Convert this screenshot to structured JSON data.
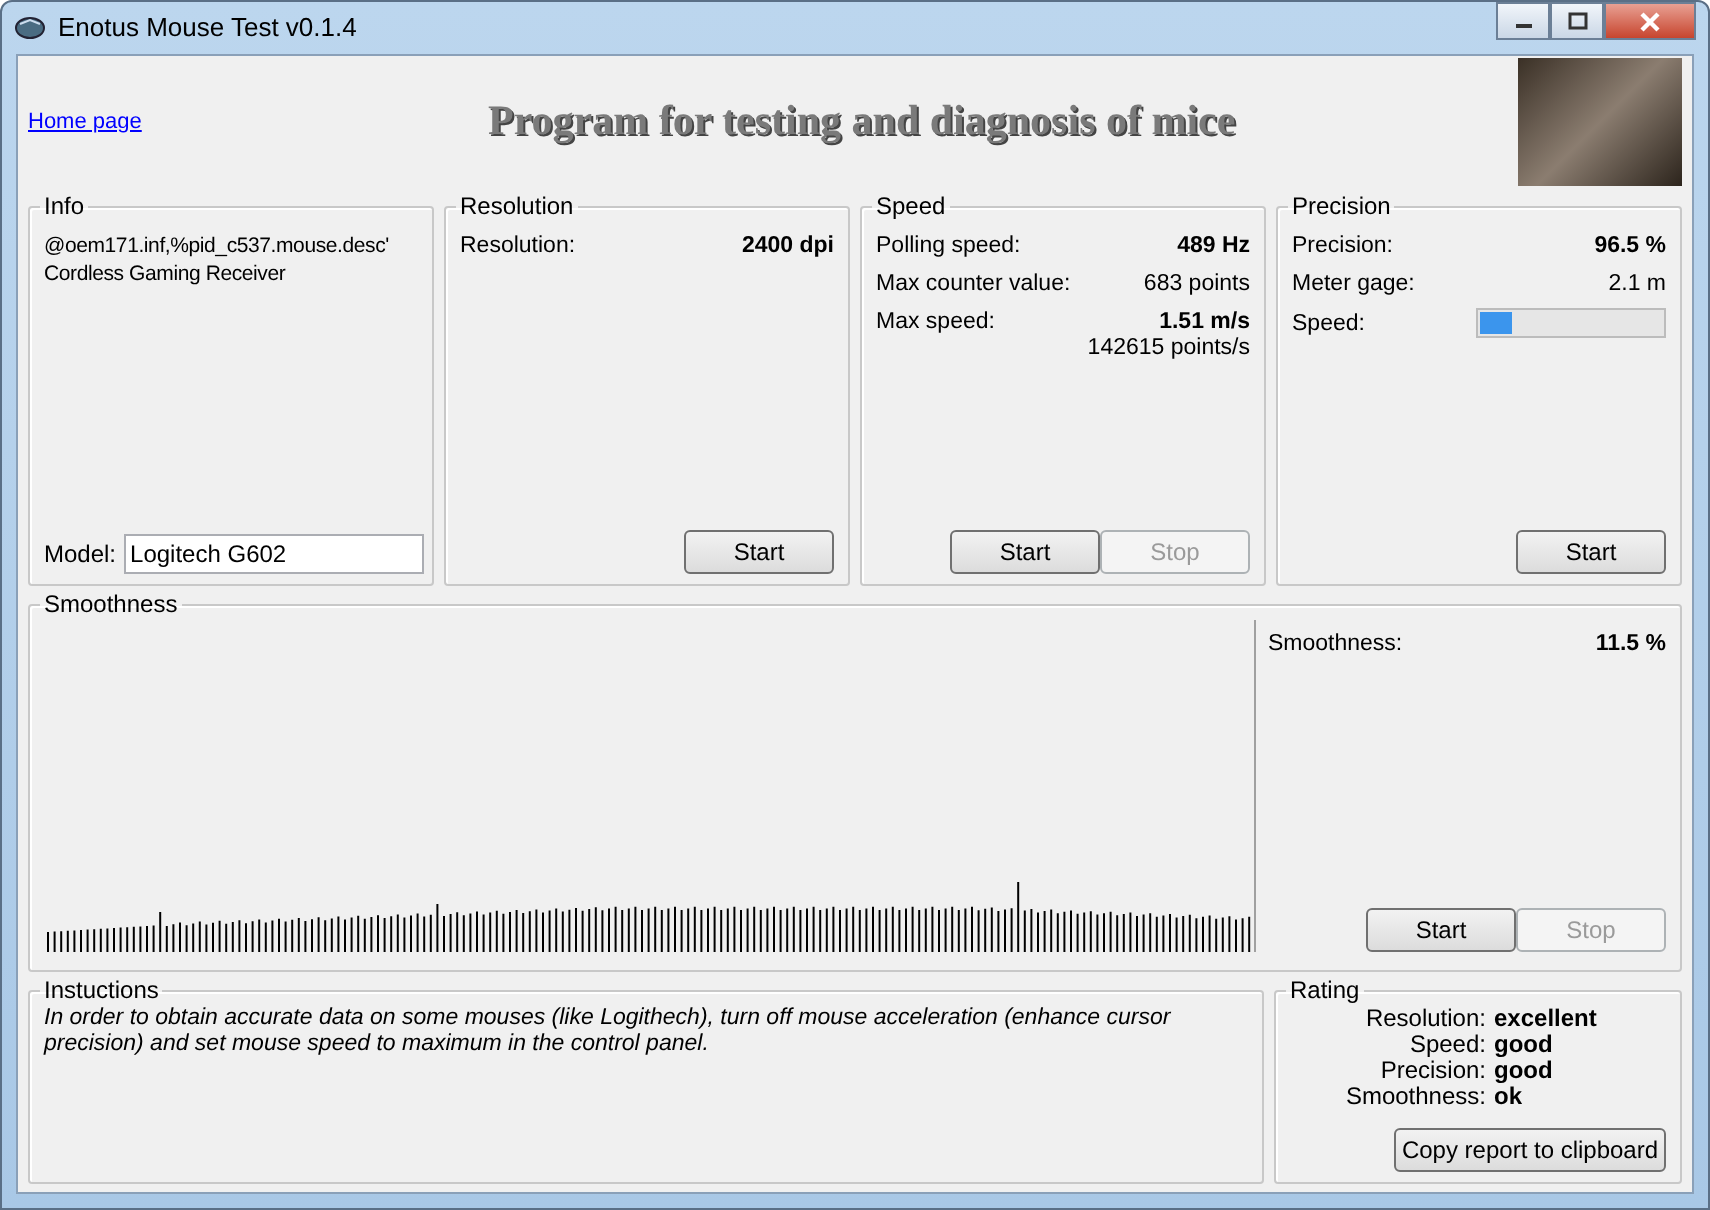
{
  "window": {
    "title": "Enotus Mouse Test v0.1.4"
  },
  "header": {
    "home_link": "Home page",
    "heading": "Program for testing and diagnosis of mice"
  },
  "info": {
    "title": "Info",
    "lines": [
      "@oem171.inf,%pid_c537.mouse.desc'",
      "Cordless Gaming Receiver"
    ],
    "model_label": "Model:",
    "model_value": "Logitech G602"
  },
  "panels": [
    {
      "title": "Resolution",
      "rows": [
        {
          "kind": "value",
          "label": "Resolution:",
          "value": "2400 dpi",
          "bold": true
        }
      ],
      "buttons": [
        {
          "label": "Start",
          "disabled": false
        }
      ]
    },
    {
      "title": "Speed",
      "rows": [
        {
          "kind": "value",
          "label": "Polling speed:",
          "value": "489 Hz",
          "bold": true
        },
        {
          "kind": "value",
          "label": "Max counter value:",
          "value": "683 points",
          "bold": false
        },
        {
          "kind": "value",
          "label": "Max  speed:",
          "value": "1.51 m/s",
          "bold": true,
          "sub": "142615 points/s"
        }
      ],
      "buttons": [
        {
          "label": "Start",
          "disabled": false
        },
        {
          "label": "Stop",
          "disabled": true
        }
      ]
    },
    {
      "title": "Precision",
      "rows": [
        {
          "kind": "value",
          "label": "Precision:",
          "value": "96.5 %",
          "bold": true
        },
        {
          "kind": "value",
          "label": "Meter gage:",
          "value": "2.1 m",
          "bold": false
        },
        {
          "kind": "meter",
          "label": "Speed:",
          "level": 0.18
        }
      ],
      "buttons": [
        {
          "label": "Start",
          "disabled": false
        }
      ]
    }
  ],
  "smoothness": {
    "title": "Smoothness",
    "rows": [
      {
        "kind": "value",
        "label": "Smoothness:",
        "value": "11.5 %",
        "bold": true
      }
    ],
    "buttons": [
      {
        "label": "Start",
        "disabled": false
      },
      {
        "label": "Stop",
        "disabled": true
      }
    ]
  },
  "instructions": {
    "title": "Instuctions",
    "text": "In order to obtain accurate data on some mouses (like Logithech), turn off mouse acceleration (enhance cursor precision) and set mouse speed to maximum in the control panel."
  },
  "rating": {
    "title": "Rating",
    "items": [
      {
        "label": "Resolution:",
        "value": "excellent"
      },
      {
        "label": "Speed:",
        "value": "good"
      },
      {
        "label": "Precision:",
        "value": "good"
      },
      {
        "label": "Smoothness:",
        "value": "ok"
      }
    ],
    "button": "Copy report to clipboard"
  }
}
